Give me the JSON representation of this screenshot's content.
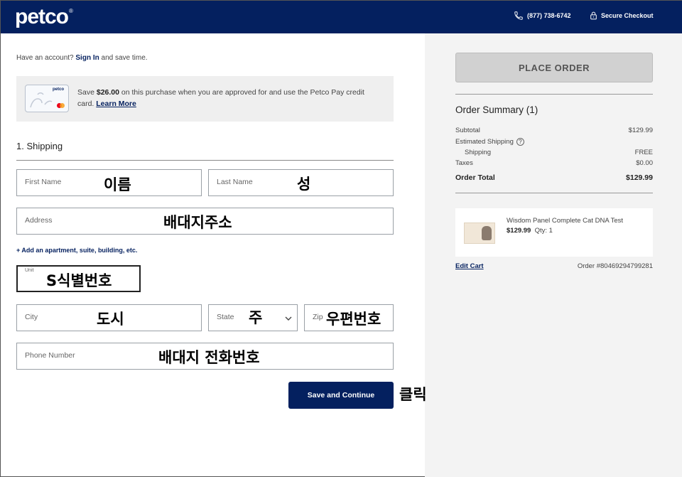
{
  "header": {
    "logo": "petco",
    "phone": "(877) 738-6742",
    "secure_checkout": "Secure Checkout"
  },
  "account": {
    "prefix": "Have an account? ",
    "sign_in": "Sign In",
    "suffix": " and save time."
  },
  "promo": {
    "card_logo": "petco",
    "text_1": "Save ",
    "amount": "$26.00",
    "text_2": " on this purchase when you are approved for and use the Petco Pay credit card. ",
    "learn_more": "Learn More"
  },
  "shipping": {
    "title": "1. Shipping",
    "first_name": {
      "placeholder": "First Name",
      "value": "이름"
    },
    "last_name": {
      "placeholder": "Last Name",
      "value": "성"
    },
    "address": {
      "placeholder": "Address",
      "value": "배대지주소"
    },
    "add_apartment": "+ Add an apartment, suite, building, etc.",
    "unit": {
      "placeholder": "Unit",
      "value": "S식별번호"
    },
    "city": {
      "placeholder": "City",
      "value": "도시"
    },
    "state": {
      "placeholder": "State",
      "value": "주"
    },
    "zip": {
      "placeholder": "Zip",
      "value": "우편번호"
    },
    "phone": {
      "placeholder": "Phone Number",
      "value": "배대지 전화번호"
    },
    "save_button": "Save and Continue",
    "click_note": "클릭"
  },
  "summary": {
    "place_order": "PLACE ORDER",
    "title": "Order Summary (1)",
    "subtotal_label": "Subtotal",
    "subtotal_value": "$129.99",
    "est_shipping_label": "Estimated Shipping",
    "shipping_label": "Shipping",
    "shipping_value": "FREE",
    "taxes_label": "Taxes",
    "taxes_value": "$0.00",
    "total_label": "Order Total",
    "total_value": "$129.99",
    "item_name": "Wisdom Panel Complete Cat DNA Test",
    "item_price": "$129.99",
    "item_qty": "Qty: 1",
    "edit_cart": "Edit Cart",
    "order_number": "Order #80469294799281"
  },
  "colors": {
    "brand_navy": "#04205f",
    "panel_gray": "#f3f3f3"
  }
}
